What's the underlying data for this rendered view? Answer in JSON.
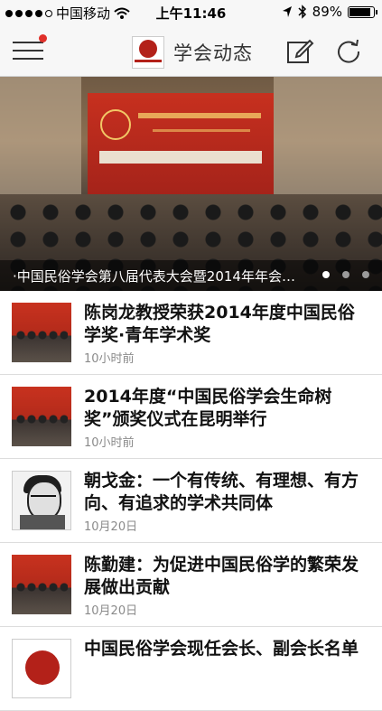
{
  "status_bar": {
    "carrier": "中国移动",
    "time": "上午11:46",
    "battery": "89%",
    "battery_level": 0.89,
    "signal_bars_filled": 4,
    "signal_bars_total": 5
  },
  "nav": {
    "title": "学会动态",
    "has_notification": true
  },
  "banner": {
    "caption": "·中国民俗学会第八届代表大会暨2014年年会…",
    "slide_count": 3,
    "active_slide": 1
  },
  "news": [
    {
      "title": "陈岗龙教授荣获2014年度中国民俗学奖·青年学术奖",
      "time": "10小时前",
      "thumb": "award-photo"
    },
    {
      "title": "2014年度“中国民俗学会生命树奖”颁奖仪式在昆明举行",
      "time": "10小时前",
      "thumb": "ceremony-photo"
    },
    {
      "title": "朝戈金：一个有传统、有理想、有方向、有追求的学术共同体",
      "time": "10月20日",
      "thumb": "portrait-sketch"
    },
    {
      "title": "陈勤建：为促进中国民俗学的繁荣发展做出贡献",
      "time": "10月20日",
      "thumb": "speaker-photo"
    },
    {
      "title": "中国民俗学会现任会长、副会长名单",
      "time": "",
      "thumb": "society-logo"
    }
  ],
  "colors": {
    "accent_red": "#b32119",
    "badge_red": "#e0302a",
    "bar_bg": "#f7f7f7"
  },
  "icons": [
    "menu-icon",
    "edit-icon",
    "refresh-icon",
    "wifi-icon",
    "location-icon",
    "bluetooth-icon",
    "battery-icon"
  ]
}
